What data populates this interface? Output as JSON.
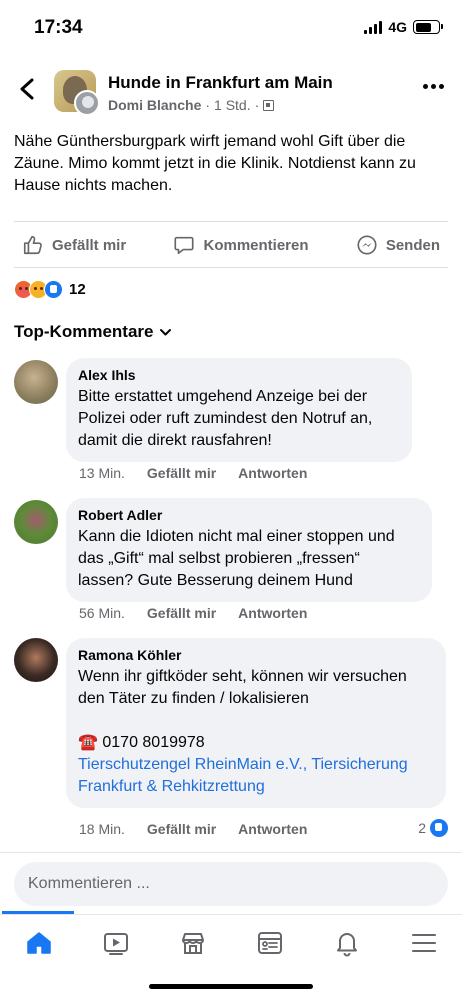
{
  "status": {
    "time": "17:34",
    "network": "4G"
  },
  "header": {
    "group_name": "Hunde in Frankfurt am Main",
    "author": "Domi Blanche",
    "separator": "·",
    "time": "1 Std.",
    "separator2": "·"
  },
  "post": {
    "text": "Nähe Günthersburgpark wirft jemand wohl Gift über die Zäune. Mimo kommt jetzt in die Klinik. Notdienst kann zu Hause nichts machen."
  },
  "actions": {
    "like": "Gefällt mir",
    "comment": "Kommentieren",
    "share": "Senden"
  },
  "reactions": {
    "count": "12",
    "types": [
      "angry",
      "sad",
      "like"
    ]
  },
  "top_comments_label": "Top-Kommentare",
  "comments": [
    {
      "name": "Alex Ihls",
      "lines": [
        "Bitte erstattet umgehend Anzeige bei der",
        "Polizei oder ruft zumindest den Notruf an,",
        "damit die direkt rausfahren!"
      ],
      "time": "13 Min.",
      "like": "Gefällt mir",
      "reply": "Antworten"
    },
    {
      "name": "Robert Adler",
      "lines": [
        "Kann die Idioten nicht mal einer stoppen und",
        "das „Gift“ mal selbst probieren „fressen“",
        "lassen? Gute Besserung deinem Hund"
      ],
      "time": "56 Min.",
      "like": "Gefällt mir",
      "reply": "Antworten"
    },
    {
      "name": "Ramona Köhler",
      "lines": [
        "Wenn ihr giftköder seht, können wir versuchen",
        "den Täter zu finden / lokalisieren"
      ],
      "phone": "☎️ 0170 8019978",
      "link_lines": [
        "Tierschutzengel RheinMain e.V., Tiersicherung",
        "Frankfurt & Rehkitzrettung"
      ],
      "time": "18 Min.",
      "like": "Gefällt mir",
      "reply": "Antworten",
      "like_count": "2"
    }
  ],
  "comment_input": {
    "placeholder": "Kommentieren ..."
  },
  "tabbar": {
    "tabs": [
      "home-icon",
      "video-icon",
      "marketplace-icon",
      "news-icon",
      "bell-icon",
      "menu-icon"
    ],
    "active_color": "#1877f2"
  },
  "colors": {
    "accent": "#1877f2",
    "secondary_text": "#65676b",
    "bubble": "#f0f2f5",
    "link": "#216fdb"
  }
}
